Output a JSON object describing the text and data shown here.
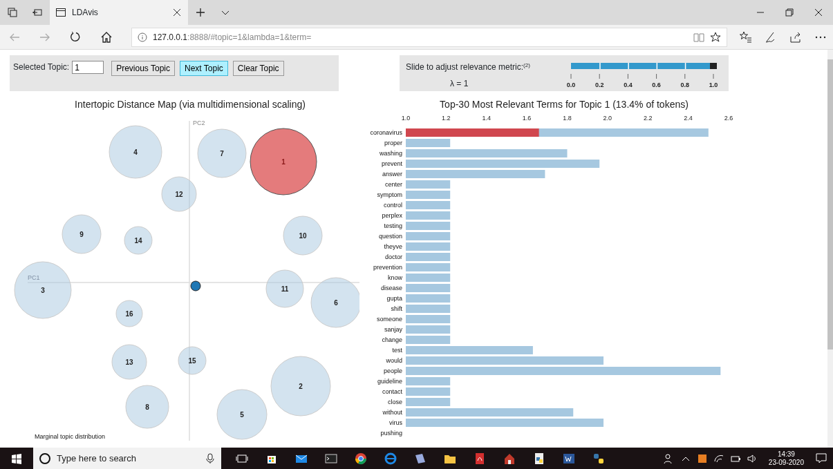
{
  "browser": {
    "tabs": [
      {
        "title": "LDAvis",
        "selected": true
      }
    ],
    "address": {
      "host": "127.0.0.1",
      "rest": ":8888/#topic=1&lambda=1&term="
    }
  },
  "controls": {
    "label": "Selected Topic:",
    "value": "1",
    "buttons": [
      {
        "label": "Previous Topic",
        "highlighted": false
      },
      {
        "label": "Next Topic",
        "highlighted": true
      },
      {
        "label": "Clear Topic",
        "highlighted": false
      }
    ]
  },
  "relevance": {
    "label": "Slide to adjust relevance metric:$^{(2)}$",
    "lambda": "λ = 1",
    "level": 1,
    "ticks": [
      "0.0",
      "0.2",
      "0.4",
      "0.6",
      "0.8",
      "1.0"
    ]
  },
  "topic_map": {
    "title": "Intertopic Distance Map (via multidimensional scaling)",
    "x_axis": "PC1",
    "y_axis": "PC2",
    "footer": "Marginal topic distribution",
    "topics": [
      {
        "label": "4",
        "selected": false
      },
      {
        "label": "7",
        "selected": false
      },
      {
        "label": "1",
        "selected": true
      },
      {
        "label": "12",
        "selected": false
      },
      {
        "label": "9",
        "selected": false
      },
      {
        "label": "14",
        "selected": false
      },
      {
        "label": "10",
        "selected": false
      },
      {
        "label": "3",
        "selected": false
      },
      {
        "label": "11",
        "selected": false
      },
      {
        "label": "6",
        "selected": false
      },
      {
        "label": "16",
        "selected": false
      },
      {
        "label": "13",
        "selected": false
      },
      {
        "label": "15",
        "selected": false
      },
      {
        "label": "2",
        "selected": false
      },
      {
        "label": "8",
        "selected": false
      },
      {
        "label": "5",
        "selected": false
      }
    ]
  },
  "terms": {
    "chart_data": {
      "type": "bar",
      "orientation": "horizontal",
      "title": "Top-30 Most Relevant Terms for Topic 1 (13.4% of tokens)",
      "xlim": [
        1.0,
        2.6
      ],
      "xticks": [
        {
          "value": 1.0,
          "label": "1.0"
        },
        {
          "value": 1.2,
          "label": "1.2"
        },
        {
          "value": 1.4,
          "label": "1.4"
        },
        {
          "value": 1.6,
          "label": "1.6"
        },
        {
          "value": 1.8,
          "label": "1.8"
        },
        {
          "value": 2.0,
          "label": "2.0"
        },
        {
          "value": 2.2,
          "label": "2.2"
        },
        {
          "value": 2.4,
          "label": "2.4"
        },
        {
          "value": 2.6,
          "label": "2.6"
        }
      ],
      "categories": [
        "coronavirus",
        "proper",
        "washing",
        "prevent",
        "answer",
        "center",
        "symptom",
        "control",
        "perplex",
        "testing",
        "question",
        "theyve",
        "doctor",
        "prevention",
        "know",
        "disease",
        "gupta",
        "shift",
        "someone",
        "sanjay",
        "change",
        "test",
        "would",
        "people",
        "guideline",
        "contact",
        "close",
        "without",
        "virus",
        "pushing"
      ],
      "series": [
        {
          "color": "#a6c8e0",
          "values": [
            2.5,
            1.22,
            1.8,
            1.96,
            1.69,
            1.22,
            1.22,
            1.22,
            1.22,
            1.22,
            1.22,
            1.22,
            1.22,
            1.22,
            1.22,
            1.22,
            1.22,
            1.22,
            1.22,
            1.22,
            1.22,
            1.63,
            1.98,
            2.56,
            1.22,
            1.22,
            1.22,
            1.83,
            1.98,
            null
          ]
        },
        {
          "color": "#d0474f",
          "values": [
            1.66,
            null,
            null,
            null,
            null,
            null,
            null,
            null,
            null,
            null,
            null,
            null,
            null,
            null,
            null,
            null,
            null,
            null,
            null,
            null,
            null,
            null,
            null,
            null,
            null,
            null,
            null,
            null,
            null,
            null
          ]
        }
      ]
    }
  },
  "taskbar": {
    "search_placeholder": "Type here to search",
    "time": "14:39",
    "date": "23-09-2020"
  }
}
